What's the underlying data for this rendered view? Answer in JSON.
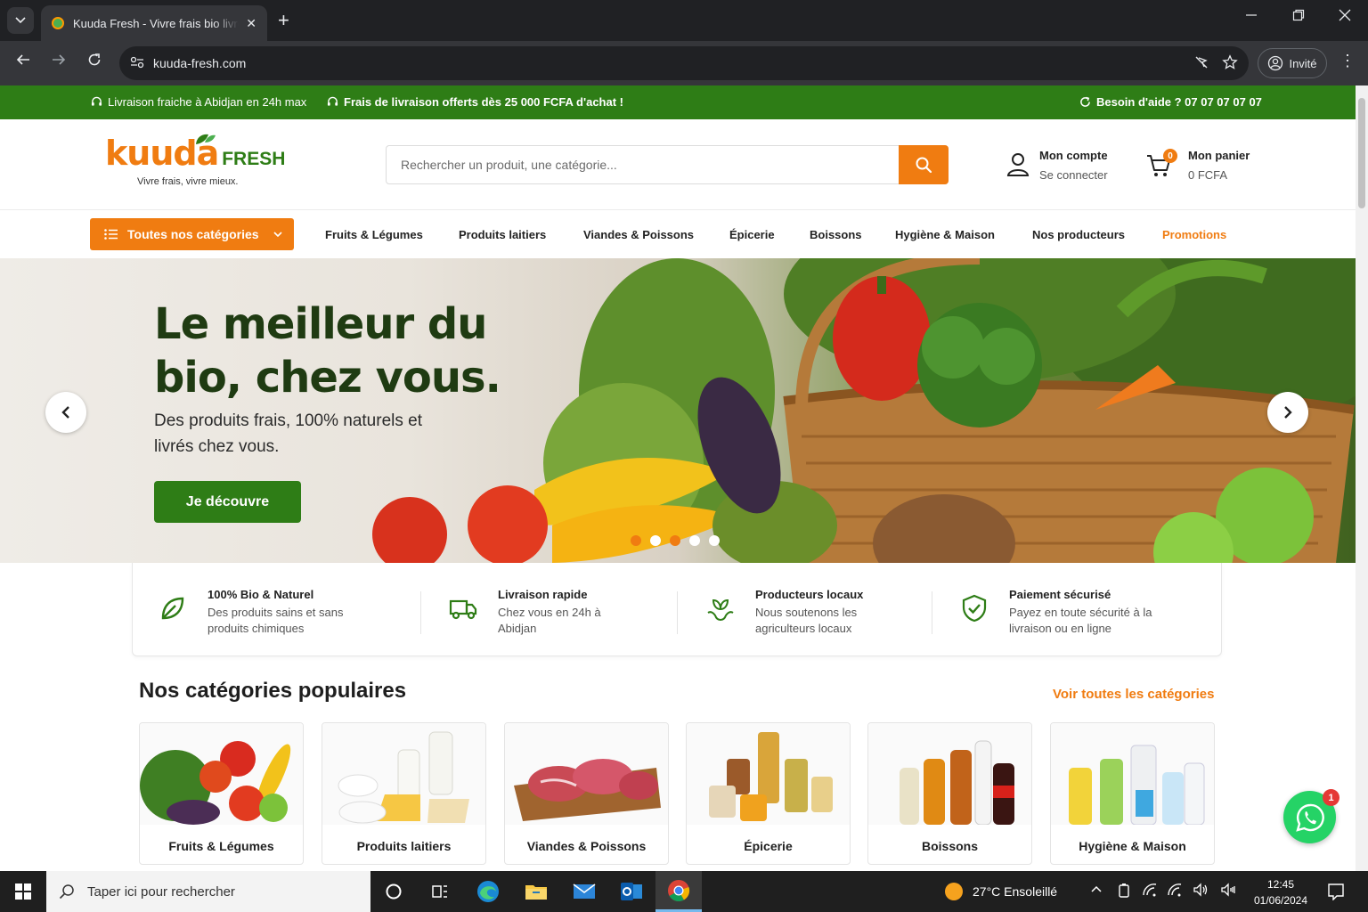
{
  "browser": {
    "tab_title": "Kuuda Fresh - Vivre frais bio livré",
    "url": "kuuda-fresh.com",
    "profile_label": "Invité"
  },
  "topbar": {
    "left1": "Livraison fraiche à Abidjan en 24h max",
    "left2": "Frais de livraison offerts dès 25 000 FCFA d'achat !",
    "help": "Besoin d'aide ? 07 07 07 07 07"
  },
  "header": {
    "logo_word": "kuuda",
    "logo_fresh": "FRESH",
    "tagline": "Vivre frais, vivre mieux.",
    "search_placeholder": "Rechercher un produit, une catégorie...",
    "account_title": "Mon compte",
    "account_sub": "Se connecter",
    "cart_title": "Mon panier",
    "cart_total": "0 FCFA",
    "cart_count": "0"
  },
  "nav": {
    "all_categories": "Toutes nos catégories",
    "links": [
      "Fruits & Légumes",
      "Produits laitiers",
      "Viandes & Poissons",
      "Épicerie",
      "Boissons",
      "Hygiène & Maison",
      "Nos producteurs",
      "Promotions"
    ]
  },
  "hero": {
    "title": "Le meilleur du bio, chez vous.",
    "subtitle": "Des produits frais, 100% naturels et livrés chez vous.",
    "cta": "Je découvre",
    "slides_total": 5,
    "active_slide": 1
  },
  "features": [
    {
      "icon": "leaf-icon",
      "title": "100% Bio & Naturel",
      "desc": "Des produits sains et sans produits chimiques"
    },
    {
      "icon": "truck-icon",
      "title": "Livraison rapide",
      "desc": "Chez vous en 24h à Abidjan"
    },
    {
      "icon": "sprout-hands-icon",
      "title": "Producteurs locaux",
      "desc": "Nous soutenons les agriculteurs locaux"
    },
    {
      "icon": "shield-check-icon",
      "title": "Paiement sécurisé",
      "desc": "Payez en toute sécurité à la livraison ou en ligne"
    }
  ],
  "categories": {
    "title": "Nos catégories populaires",
    "see_all": "Voir toutes les catégories",
    "items": [
      {
        "label": "Fruits & Légumes"
      },
      {
        "label": "Produits laitiers"
      },
      {
        "label": "Viandes & Poissons"
      },
      {
        "label": "Épicerie"
      },
      {
        "label": "Boissons"
      },
      {
        "label": "Hygiène & Maison"
      }
    ]
  },
  "whatsapp": {
    "badge": "1"
  },
  "taskbar": {
    "search_placeholder": "Taper ici pour rechercher",
    "weather": "27°C  Ensoleillé",
    "time": "12:45",
    "date": "01/06/2024"
  },
  "colors": {
    "brand_orange": "#f07c11",
    "brand_green": "#2e7d16",
    "dark_green": "#1f3b12"
  }
}
